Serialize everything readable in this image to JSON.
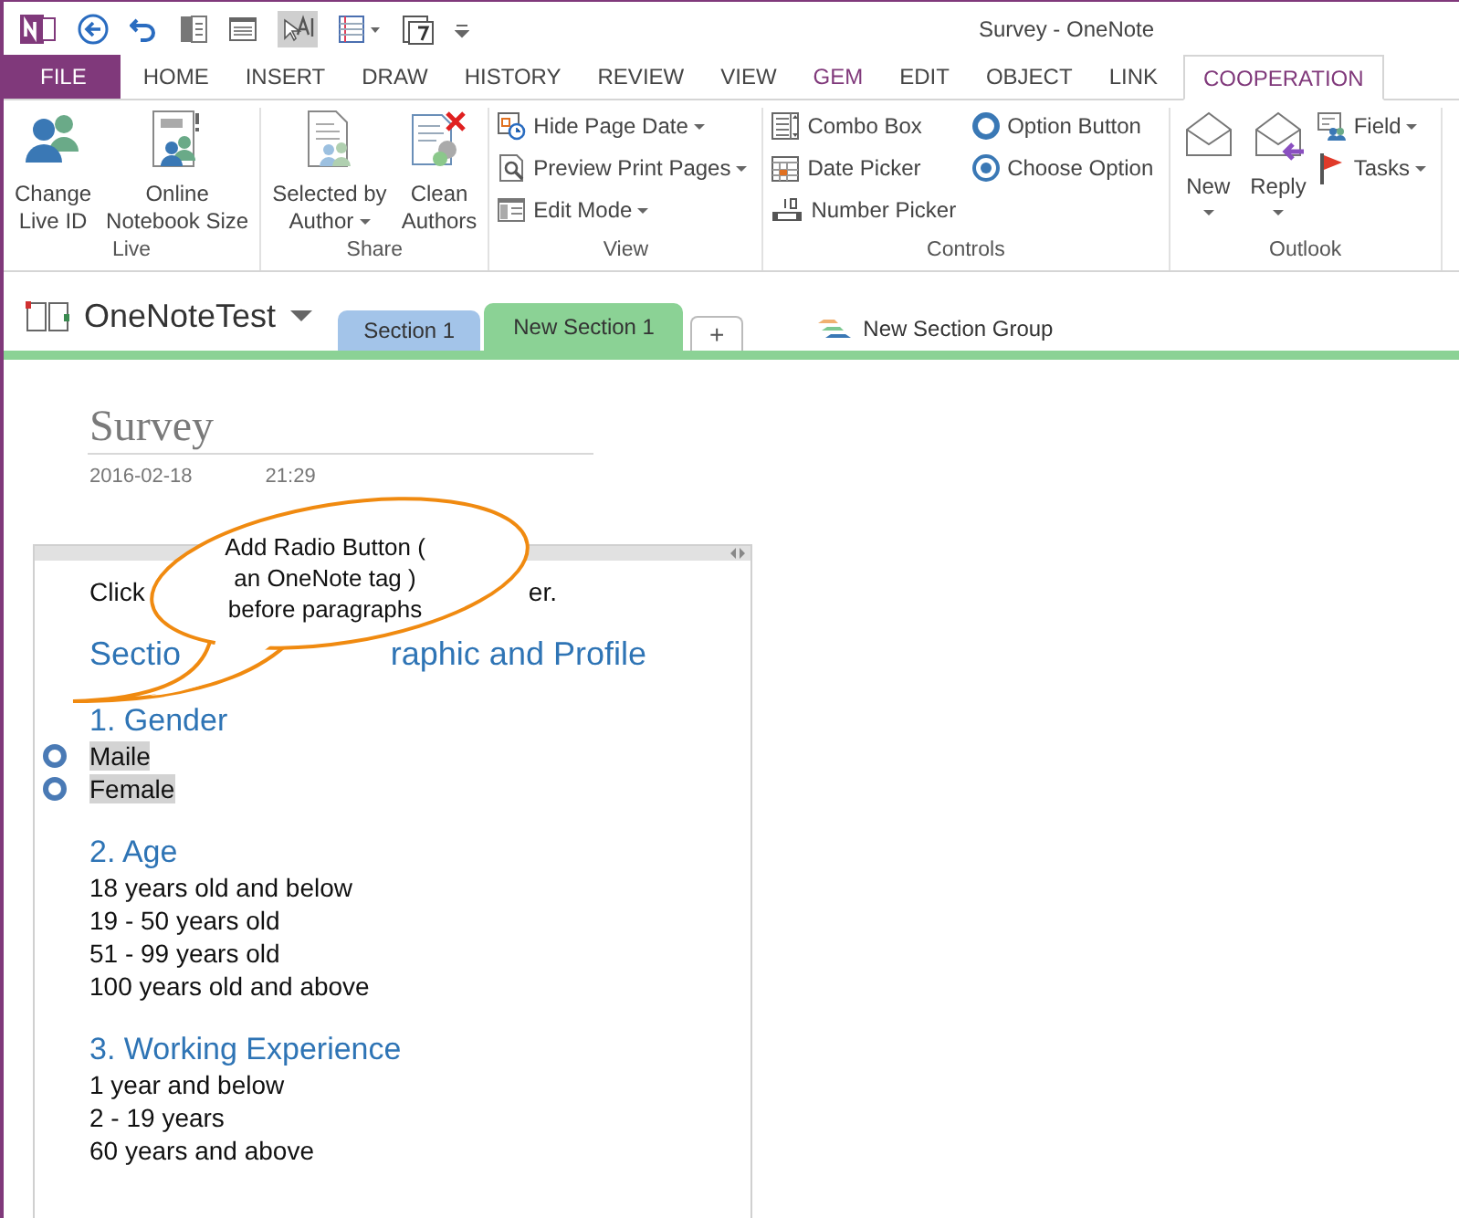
{
  "window": {
    "title": "Survey - OneNote"
  },
  "tabs": [
    {
      "label": "FILE",
      "kind": "file",
      "selected": false
    },
    {
      "label": "HOME",
      "kind": "plain",
      "selected": false
    },
    {
      "label": "INSERT",
      "kind": "plain",
      "selected": false
    },
    {
      "label": "DRAW",
      "kind": "plain",
      "selected": false
    },
    {
      "label": "HISTORY",
      "kind": "plain",
      "selected": false
    },
    {
      "label": "REVIEW",
      "kind": "plain",
      "selected": false
    },
    {
      "label": "VIEW",
      "kind": "plain",
      "selected": false
    },
    {
      "label": "GEM",
      "kind": "addin",
      "selected": false
    },
    {
      "label": "EDIT",
      "kind": "plain",
      "selected": false
    },
    {
      "label": "OBJECT",
      "kind": "plain",
      "selected": false
    },
    {
      "label": "LINK",
      "kind": "plain",
      "selected": false
    },
    {
      "label": "COOPERATION",
      "kind": "addin",
      "selected": true
    }
  ],
  "ribbon": {
    "live": {
      "label": "Live",
      "items": [
        {
          "label": "Change\nLive ID",
          "dropdown": false
        },
        {
          "label": "Online\nNotebook Size",
          "dropdown": false
        }
      ]
    },
    "share": {
      "label": "Share",
      "items": [
        {
          "label": "Selected by\nAuthor",
          "dropdown": true
        },
        {
          "label": "Clean\nAuthors",
          "dropdown": false
        }
      ]
    },
    "view": {
      "label": "View",
      "items": [
        {
          "label": "Hide Page Date",
          "dropdown": true
        },
        {
          "label": "Preview Print Pages",
          "dropdown": true
        },
        {
          "label": "Edit Mode",
          "dropdown": true
        }
      ]
    },
    "controls": {
      "label": "Controls",
      "items": [
        {
          "label": "Combo Box"
        },
        {
          "label": "Date Picker"
        },
        {
          "label": "Number Picker"
        },
        {
          "label": "Option Button"
        },
        {
          "label": "Choose Option"
        }
      ]
    },
    "outlook": {
      "label": "Outlook",
      "items": [
        {
          "label": "New",
          "dropdown": true
        },
        {
          "label": "Reply",
          "dropdown": true
        },
        {
          "label": "Field",
          "dropdown": true
        },
        {
          "label": "Tasks",
          "dropdown": true
        }
      ]
    }
  },
  "notebook": {
    "name": "OneNoteTest",
    "sections": [
      {
        "label": "Section 1",
        "color": "#a3c4e9",
        "selected": false
      },
      {
        "label": "New Section 1",
        "color": "#8bd295",
        "selected": true
      }
    ],
    "add_tab": "+",
    "section_group": "New Section Group"
  },
  "page": {
    "title": "Survey",
    "date": "2016-02-18",
    "time": "21:29",
    "intro": [
      "Click",
      "er."
    ],
    "heading": [
      "Sectio",
      "raphic and Profile"
    ],
    "questions": [
      {
        "title": "1. Gender",
        "options": [
          {
            "label": "Maile",
            "tagged": true,
            "highlighted": true
          },
          {
            "label": "Female",
            "tagged": true,
            "highlighted": true
          }
        ]
      },
      {
        "title": "2. Age",
        "options": [
          {
            "label": "18 years old and below",
            "tagged": false,
            "highlighted": false
          },
          {
            "label": "19 - 50 years old",
            "tagged": false,
            "highlighted": false
          },
          {
            "label": "51 - 99 years old",
            "tagged": false,
            "highlighted": false
          },
          {
            "label": "100 years old and above",
            "tagged": false,
            "highlighted": false
          }
        ]
      },
      {
        "title": "3. Working Experience",
        "options": [
          {
            "label": "1 year and below",
            "tagged": false,
            "highlighted": false
          },
          {
            "label": "2 - 19 years",
            "tagged": false,
            "highlighted": false
          },
          {
            "label": "60 years and above",
            "tagged": false,
            "highlighted": false
          }
        ]
      }
    ]
  },
  "callout": {
    "text": "Add Radio Button (\nan OneNote tag )\nbefore paragraphs"
  }
}
